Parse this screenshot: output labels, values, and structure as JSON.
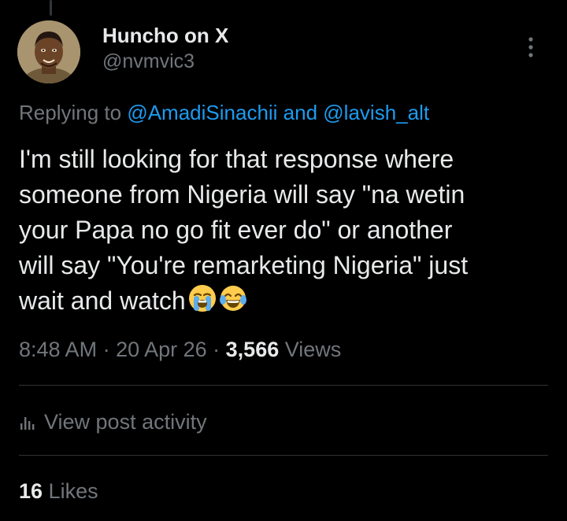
{
  "author": {
    "display_name": "Huncho on X",
    "handle": "@nvmvic3",
    "avatar": "avatar-portrait"
  },
  "reply_context": {
    "prefix": "Replying to ",
    "mention_1": "@AmadiSinachii",
    "conjunction": " and ",
    "mention_2": "@lavish_alt"
  },
  "tweet": {
    "lines": [
      "I'm still looking for that response where",
      "someone from Nigeria will say \"na wetin",
      "your Papa no go fit ever do\" or another",
      "will say \"You're remarketing Nigeria\" just",
      "wait and watch"
    ],
    "emojis": [
      "loudly-crying-face-emoji",
      "face-with-tears-of-joy-emoji"
    ]
  },
  "meta": {
    "time": "8:48 AM",
    "separator": " · ",
    "date": "20 Apr 26",
    "views_count": "3,566",
    "views_label": " Views"
  },
  "activity": {
    "icon": "bar-chart-icon",
    "label": "View post activity"
  },
  "likes": {
    "count": "16",
    "label": " Likes"
  },
  "colors": {
    "background": "#000000",
    "text_primary": "#e7e9ea",
    "text_secondary": "#71767b",
    "link": "#1d9bf0",
    "divider": "#2f3336"
  },
  "icons": {
    "more": "more-vertical-icon"
  }
}
